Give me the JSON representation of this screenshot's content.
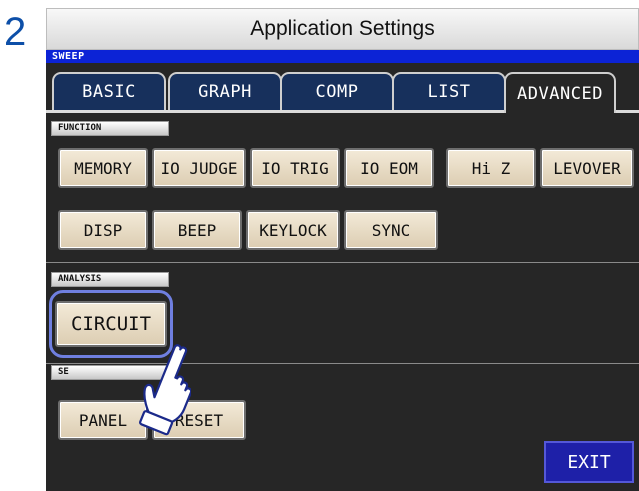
{
  "step_number": "2",
  "screen": {
    "title": "Application Settings",
    "mode_label": "SWEEP",
    "tabs": [
      {
        "label": "BASIC",
        "active": false
      },
      {
        "label": "GRAPH",
        "active": false
      },
      {
        "label": "COMP",
        "active": false
      },
      {
        "label": "LIST",
        "active": false
      },
      {
        "label": "ADVANCED",
        "active": true
      }
    ],
    "sections": {
      "function": {
        "label": "FUNCTION",
        "buttons": [
          "MEMORY",
          "IO JUDGE",
          "IO TRIG",
          "IO EOM",
          "Hi Z",
          "LEVOVER",
          "DISP",
          "BEEP",
          "KEYLOCK",
          "SYNC"
        ]
      },
      "analysis": {
        "label": "ANALYSIS",
        "buttons": [
          "CIRCUIT"
        ]
      },
      "setting": {
        "label": "SE",
        "buttons": [
          "PANEL",
          "RESET"
        ]
      }
    },
    "exit_label": "EXIT"
  },
  "colors": {
    "screen_bg": "#262626",
    "tab_bg": "#17305c",
    "mode_bar": "#0c23d6",
    "button_face": "#e9dec6",
    "exit_bg": "#1e20a8",
    "focus_ring": "#6f7fe0"
  }
}
